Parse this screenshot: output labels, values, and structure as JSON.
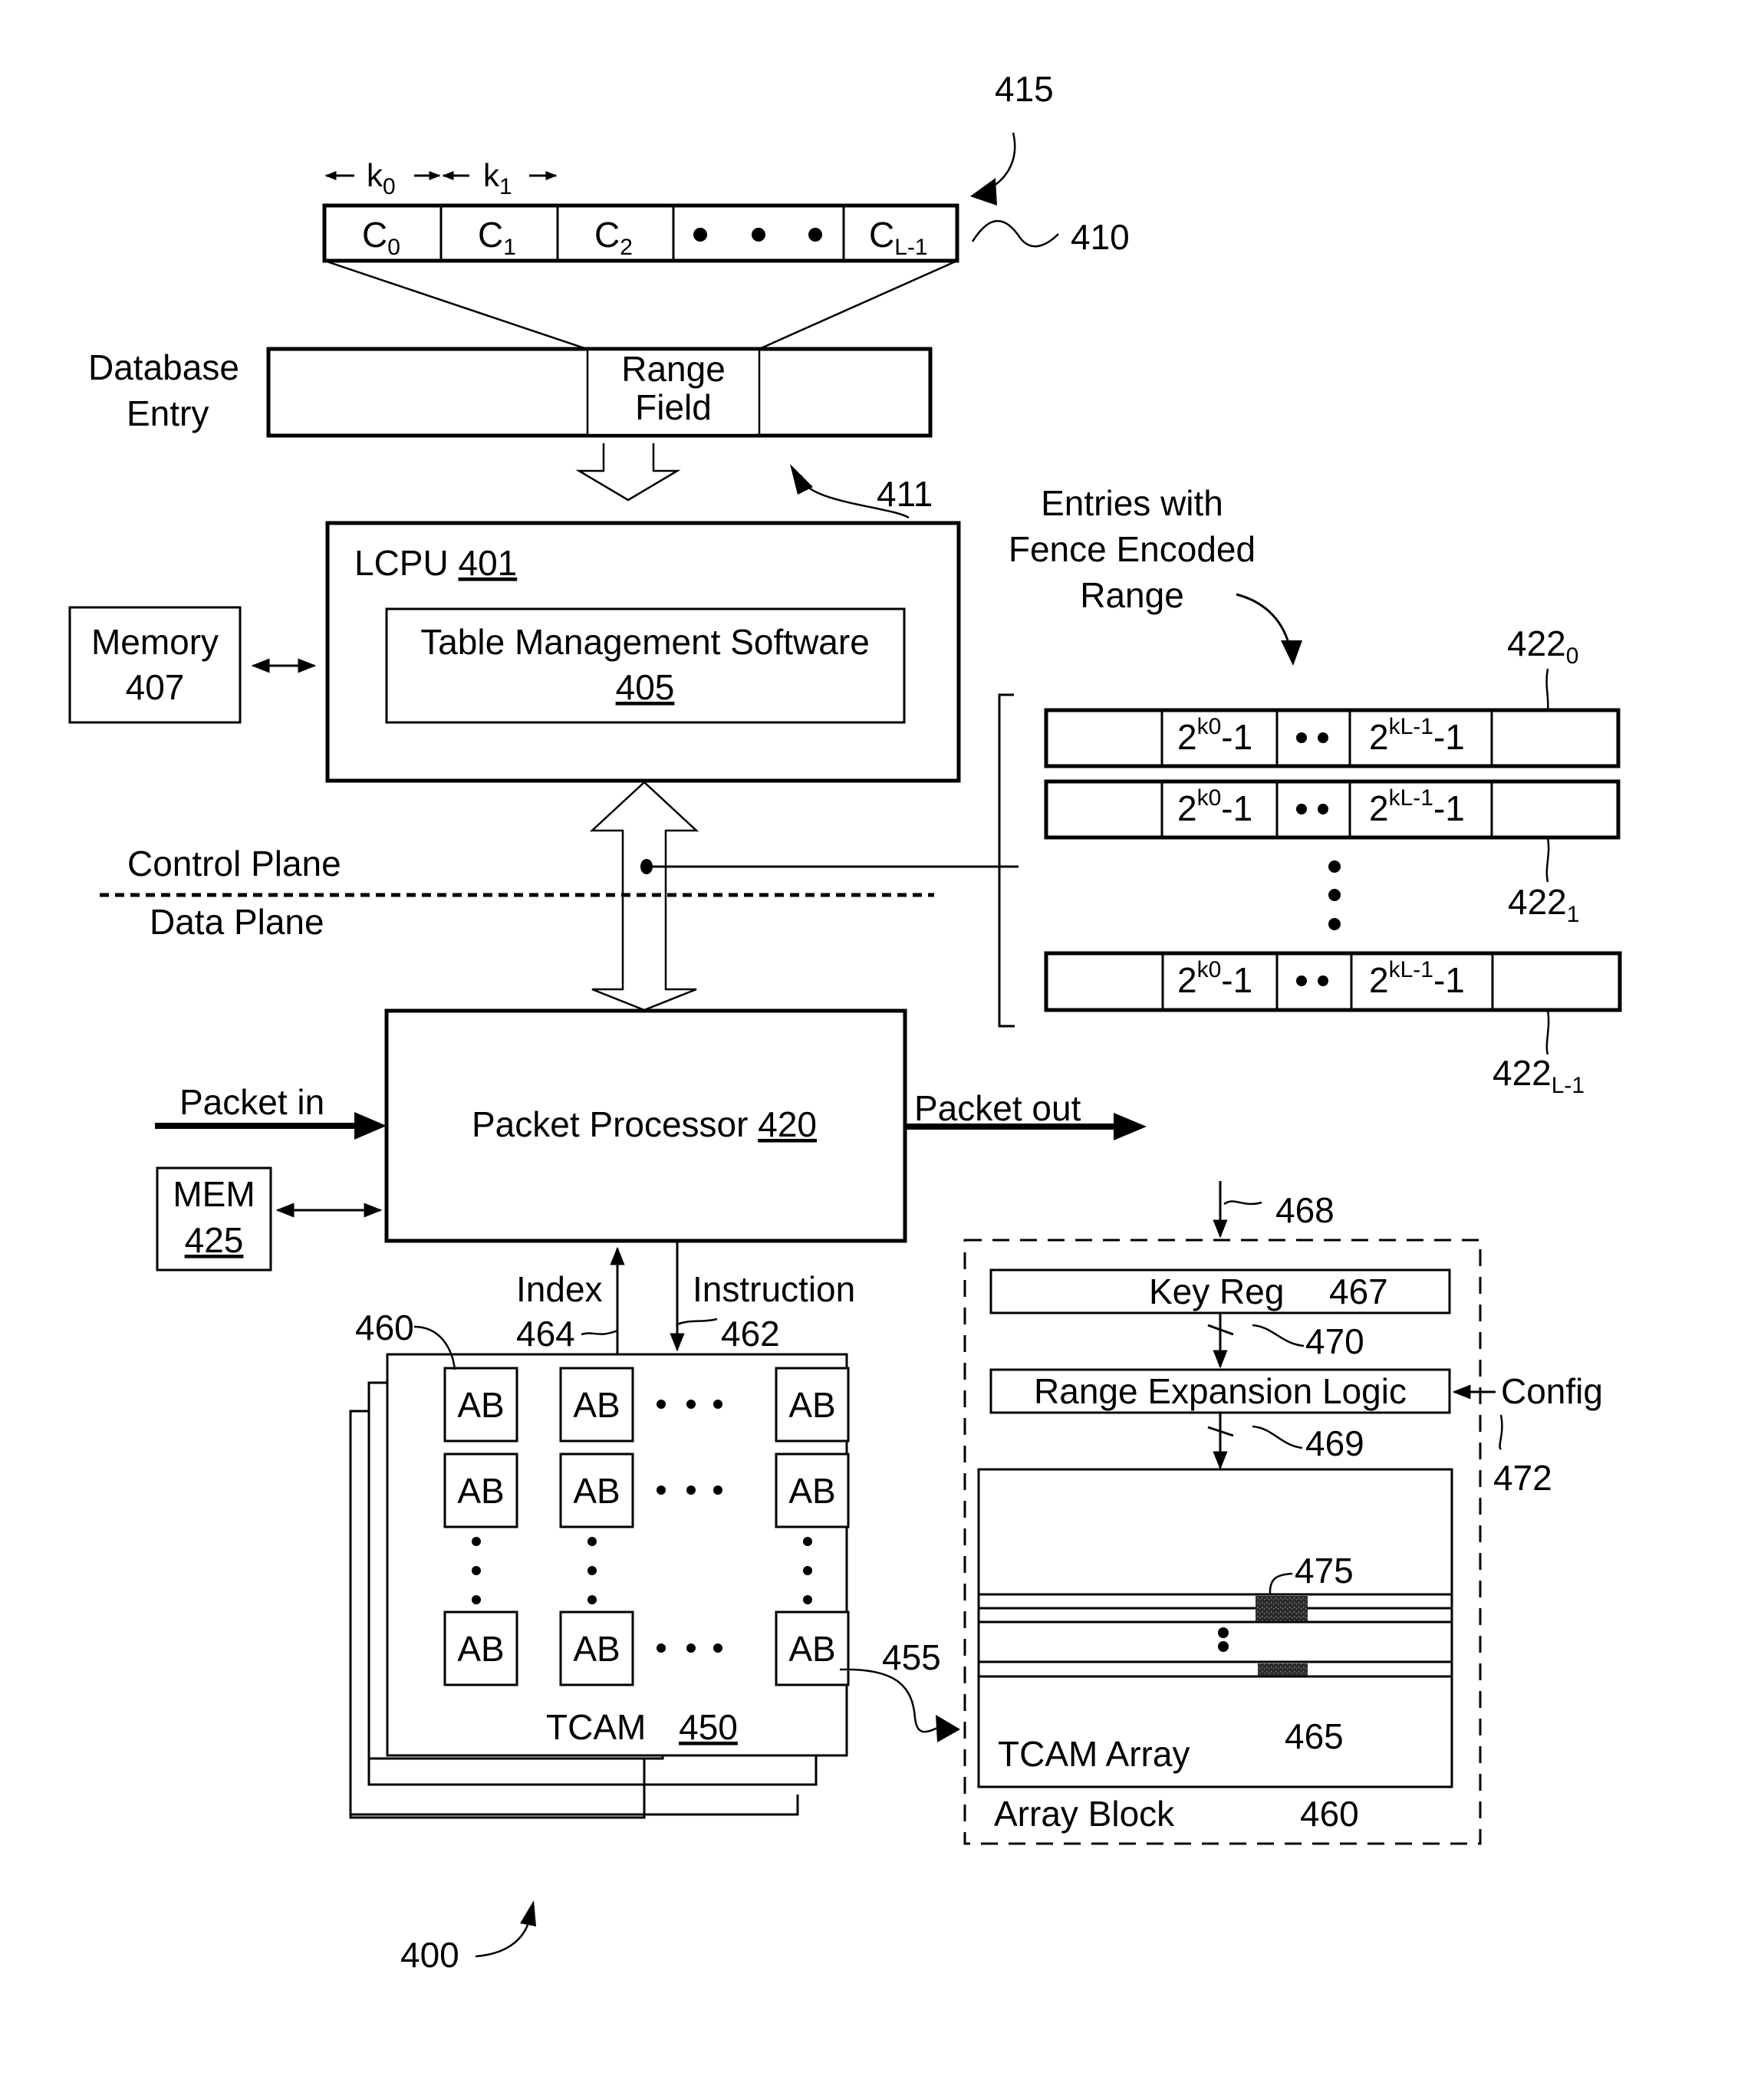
{
  "figure": {
    "ref": "400"
  },
  "key_segments": {
    "ref": "410",
    "arrow_ref": "415",
    "width_labels": [
      {
        "base": "k",
        "sub": "0"
      },
      {
        "base": "k",
        "sub": "1"
      }
    ],
    "cells": [
      {
        "base": "C",
        "sub": "0"
      },
      {
        "base": "C",
        "sub": "1"
      },
      {
        "base": "C",
        "sub": "2"
      },
      {
        "base": "• • •",
        "sub": ""
      },
      {
        "base": "C",
        "sub": "L-1"
      }
    ]
  },
  "database_entry": {
    "label_line1": "Database",
    "label_line2": "Entry",
    "range_field_line1": "Range",
    "range_field_line2": "Field",
    "arrow_ref": "411"
  },
  "lcpu": {
    "name": "LCPU",
    "ref": "401",
    "software_name": "Table Management Software",
    "software_ref": "405"
  },
  "memory": {
    "name": "Memory",
    "ref": "407"
  },
  "planes": {
    "control": "Control Plane",
    "data": "Data Plane"
  },
  "fence_entries": {
    "caption_line1": "Entries with",
    "caption_line2": "Fence Encoded",
    "caption_line3": "Range",
    "rows": [
      {
        "ref_base": "422",
        "ref_sub": "0",
        "cell1": {
          "base": "2",
          "sup": "k0",
          "tail": "-1"
        },
        "dots": "••",
        "cell2": {
          "base": "2",
          "sup": "kL-1",
          "tail": "-1"
        }
      },
      {
        "ref_base": "422",
        "ref_sub": "1",
        "cell1": {
          "base": "2",
          "sup": "k0",
          "tail": "-1"
        },
        "dots": "••",
        "cell2": {
          "base": "2",
          "sup": "kL-1",
          "tail": "-1"
        }
      },
      {
        "ref_base": "422",
        "ref_sub": "L-1",
        "cell1": {
          "base": "2",
          "sup": "k0",
          "tail": "-1"
        },
        "dots": "••",
        "cell2": {
          "base": "2",
          "sup": "kL-1",
          "tail": "-1"
        }
      }
    ]
  },
  "packet_processor": {
    "name": "Packet Processor",
    "ref": "420",
    "packet_in": "Packet in",
    "packet_out": "Packet out"
  },
  "mem": {
    "name": "MEM",
    "ref": "425"
  },
  "signals": {
    "index_label": "Index",
    "index_ref": "464",
    "instruction_label": "Instruction",
    "instruction_ref": "462"
  },
  "tcam": {
    "name": "TCAM",
    "ref": "450",
    "block_ref": "460",
    "link_ref": "455",
    "block_label": "AB"
  },
  "array_block": {
    "input_ref": "468",
    "key_reg_name": "Key Reg",
    "key_reg_ref": "467",
    "bus1_ref": "470",
    "range_logic_name": "Range Expansion Logic",
    "config_label": "Config",
    "config_ref": "472",
    "bus2_ref": "469",
    "entry_ref": "475",
    "tcam_array_name": "TCAM Array",
    "tcam_array_ref": "465",
    "block_name": "Array Block",
    "block_ref": "460"
  }
}
